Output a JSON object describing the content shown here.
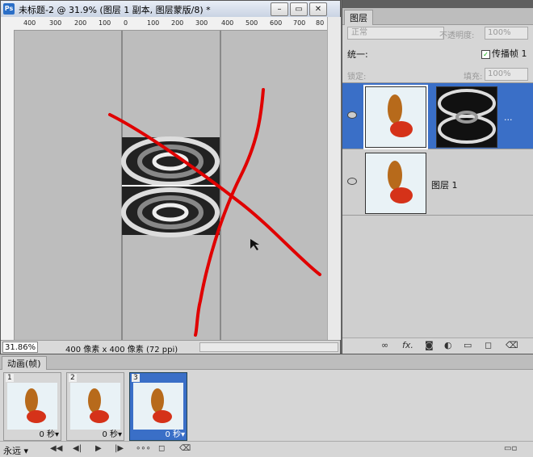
{
  "document": {
    "app_icon_label": "Ps",
    "title": "未标题-2 @ 31.9% (图层 1 副本, 图层蒙版/8) *",
    "hruler_labels": [
      "400",
      "300",
      "200",
      "100",
      "0",
      "100",
      "200",
      "300",
      "400",
      "500",
      "600",
      "700",
      "80"
    ],
    "zoom": "31.86%",
    "doc_info": "400 像素 x 400 像素 (72 ppi)",
    "win_buttons": {
      "minimize": "–",
      "restore": "▭",
      "close": "✕"
    }
  },
  "layers_panel": {
    "tab_label": "图层",
    "blend_mode": "正常",
    "opacity_label": "不透明度:",
    "opacity_value": "100%",
    "unify_label": "统一:",
    "propagate_label": "传播帧 1",
    "propagate_checked": true,
    "lock_label": "锁定:",
    "fill_label": "填充:",
    "fill_value": "100%",
    "layers": [
      {
        "name": "",
        "selected": true,
        "has_mask": true,
        "link_glyph": "..."
      },
      {
        "name": "图层 1",
        "selected": false,
        "has_mask": false
      }
    ],
    "bottom_icons": [
      "link-icon",
      "fx-icon",
      "mask-icon",
      "adjustment-icon",
      "group-icon",
      "new-layer-icon",
      "trash-icon"
    ],
    "fx_label": "fx."
  },
  "animation_panel": {
    "tab_label": "动画(帧)",
    "frames": [
      {
        "number": "1",
        "delay": "0 秒▾",
        "selected": false
      },
      {
        "number": "2",
        "delay": "0 秒▾",
        "selected": false
      },
      {
        "number": "3",
        "delay": "0 秒▾",
        "selected": true
      }
    ],
    "loop": "永远 ▾"
  },
  "colors": {
    "selection_blue": "#3a6fc7",
    "red_stroke": "#e00000"
  }
}
